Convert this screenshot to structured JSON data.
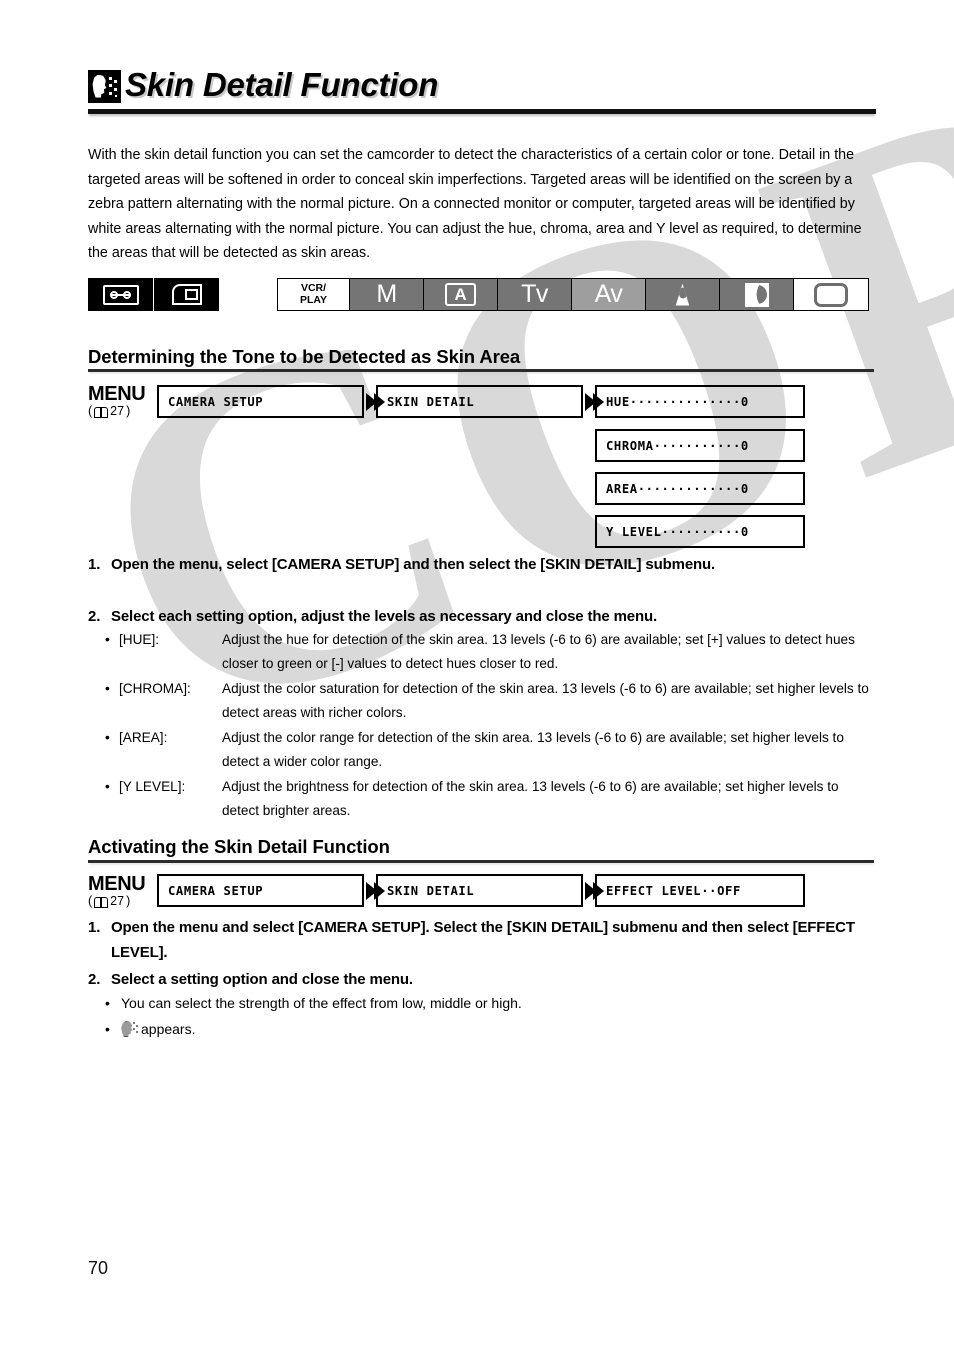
{
  "page": {
    "number": "70",
    "watermark": "COPY"
  },
  "header": {
    "icon": "skin-detail-icon",
    "title": "Skin Detail Function"
  },
  "intro": "With the skin detail function you can set the camcorder to detect the characteristics of a certain color or tone. Detail in the targeted areas will be softened in order to conceal skin imperfections. Targeted areas will be identified on the screen by a zebra pattern alternating with the normal picture. On a connected monitor or computer, targeted areas will be identified by white areas alternating with the normal picture. You can adjust the hue, chroma, area and Y level as required, to determine the areas that will be detected as skin areas.",
  "media_bar": {
    "items": [
      {
        "icon": "tape-icon",
        "label": ""
      },
      {
        "icon": "memory-card-icon",
        "label": ""
      }
    ]
  },
  "mode_bar": {
    "cells": [
      {
        "label": "VCR/\nPLAY",
        "line1": "VCR/",
        "line2": "PLAY",
        "style": "white",
        "icon": ""
      },
      {
        "label": "M",
        "style": "grey",
        "icon": ""
      },
      {
        "label": "A",
        "style": "grey",
        "icon": "auto-mode-icon"
      },
      {
        "label": "Tv",
        "style": "grey",
        "icon": ""
      },
      {
        "label": "Av",
        "style": "light",
        "icon": ""
      },
      {
        "label": "",
        "style": "grey",
        "icon": "spotlight-icon"
      },
      {
        "label": "",
        "style": "grey",
        "icon": "night-mode-icon"
      },
      {
        "label": "",
        "style": "white",
        "icon": "blank-mode-icon"
      }
    ]
  },
  "section1": {
    "heading": "Determining the Tone to be Detected as Skin Area",
    "menu": {
      "label": "MENU",
      "ref": "27",
      "boxes": [
        {
          "text": "CAMERA SETUP"
        },
        {
          "text": "SKIN DETAIL"
        }
      ],
      "options": [
        {
          "text": "HUE··············0"
        },
        {
          "text": "CHROMA···········0"
        },
        {
          "text": "AREA·············0"
        },
        {
          "text": "Y LEVEL··········0"
        }
      ]
    },
    "steps": [
      {
        "num": "1.",
        "text": "Open the menu, select [CAMERA SETUP] and then select the [SKIN DETAIL] submenu."
      },
      {
        "num": "2.",
        "text": "Select each setting option, adjust the levels as necessary and close the menu."
      }
    ],
    "bullets": [
      {
        "bullet": "•",
        "key": "[HUE]:",
        "value": "Adjust the hue for detection of the skin area. 13 levels (-6 to 6) are available; set [+] values to detect hues closer to green or [-] values to detect hues closer to red."
      },
      {
        "bullet": "•",
        "key": "[CHROMA]:",
        "value": "Adjust the color saturation for detection of the skin area. 13 levels (-6 to 6) are available; set higher levels to detect areas with richer colors."
      },
      {
        "bullet": "•",
        "key": "[AREA]:",
        "value": "Adjust the color range for detection of the skin area. 13 levels (-6 to 6) are available; set higher levels to detect a wider color range."
      },
      {
        "bullet": "•",
        "key": "[Y LEVEL]:",
        "value": "Adjust the brightness for detection of the skin area. 13 levels (-6 to 6) are available; set higher levels to detect brighter areas."
      }
    ]
  },
  "section2": {
    "heading": "Activating the Skin Detail Function",
    "menu": {
      "label": "MENU",
      "ref": "27",
      "boxes": [
        {
          "text": "CAMERA SETUP"
        },
        {
          "text": "SKIN DETAIL"
        },
        {
          "text": "EFFECT LEVEL··OFF"
        }
      ]
    },
    "steps": [
      {
        "num": "1.",
        "text": "Open the menu and select [CAMERA SETUP]. Select the [SKIN DETAIL] submenu and then select [EFFECT LEVEL]."
      },
      {
        "num": "2.",
        "text": "Select a setting option and close the menu."
      }
    ],
    "bullets": [
      {
        "bullet": "•",
        "text": "You can select the strength of the effect from low, middle or high."
      },
      {
        "bullet": "•",
        "text": "appears.",
        "icon": "skin-detail-indicator-icon"
      }
    ]
  }
}
